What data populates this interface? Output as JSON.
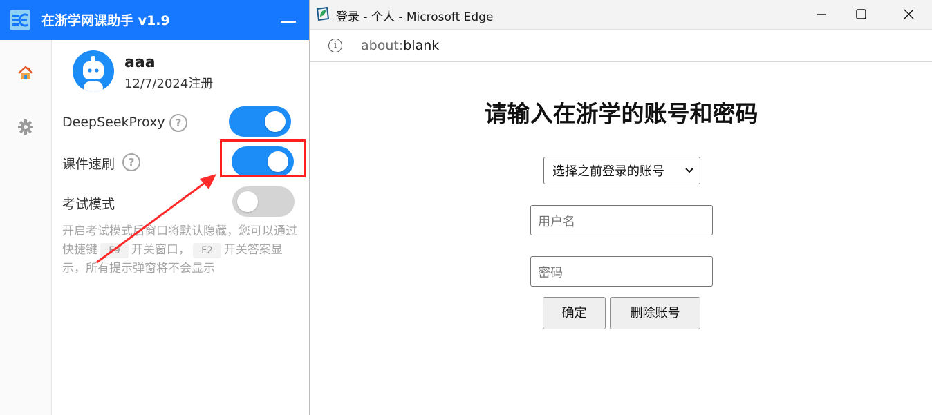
{
  "app": {
    "title": "在浙学网课助手 v1.9",
    "user": {
      "name": "aaa",
      "registered": "12/7/2024注册"
    },
    "options": [
      {
        "label": "DeepSeekProxy",
        "enabled": true
      },
      {
        "label": "课件速刷",
        "enabled": true
      },
      {
        "label": "考试模式",
        "enabled": false
      }
    ],
    "help_glyph": "?",
    "note": {
      "part1": "开启考试模式后窗口将默认隐藏，您可以通过快捷键",
      "key1": "F9",
      "part2": "开关窗口，",
      "key2": "F2",
      "part3": "开关答案显示，所有提示弹窗将不会显示"
    },
    "colors": {
      "accent": "#1677ff",
      "toggle_on": "#1c8cf7",
      "highlight": "#ff1f1f"
    }
  },
  "browser": {
    "title": "登录 - 个人 - Microsoft Edge",
    "url_scheme": "about:",
    "url_path": "blank",
    "info_glyph": "i"
  },
  "login_page": {
    "heading": "请输入在浙学的账号和密码",
    "select_label": "选择之前登录的账号",
    "username_placeholder": "用户名",
    "password_placeholder": "密码",
    "confirm_label": "确定",
    "delete_label": "删除账号"
  }
}
